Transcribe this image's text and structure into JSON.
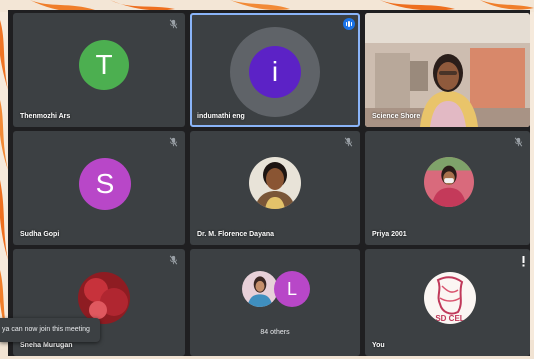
{
  "participants": [
    {
      "name": "Thenmozhi Ars",
      "initial": "T",
      "color": "#4caf50",
      "muted": true
    },
    {
      "name": "indumathi eng",
      "initial": "i",
      "color": "#5c22c6",
      "speaking": true
    },
    {
      "name": "Science Shore",
      "type": "video"
    },
    {
      "name": "Sudha Gopi",
      "initial": "S",
      "color": "#b847c8",
      "muted": true
    },
    {
      "name": "Dr. M. Florence Dayana",
      "type": "photo",
      "muted": true
    },
    {
      "name": "Priya 2001",
      "type": "photo",
      "muted": true
    },
    {
      "name": "Sneha Murugan",
      "type": "photo",
      "muted": true
    },
    {
      "others_initial": "L",
      "others_color": "#b847c8",
      "others_label": "84 others"
    },
    {
      "name": "You",
      "type": "photo",
      "badge_text": "SD CEL"
    }
  ],
  "toast": {
    "text": "ya can now join this meeting"
  },
  "icons": {
    "mute": "mic-off-icon",
    "speaking": "audio-level-icon",
    "more": "more-options-icon"
  }
}
